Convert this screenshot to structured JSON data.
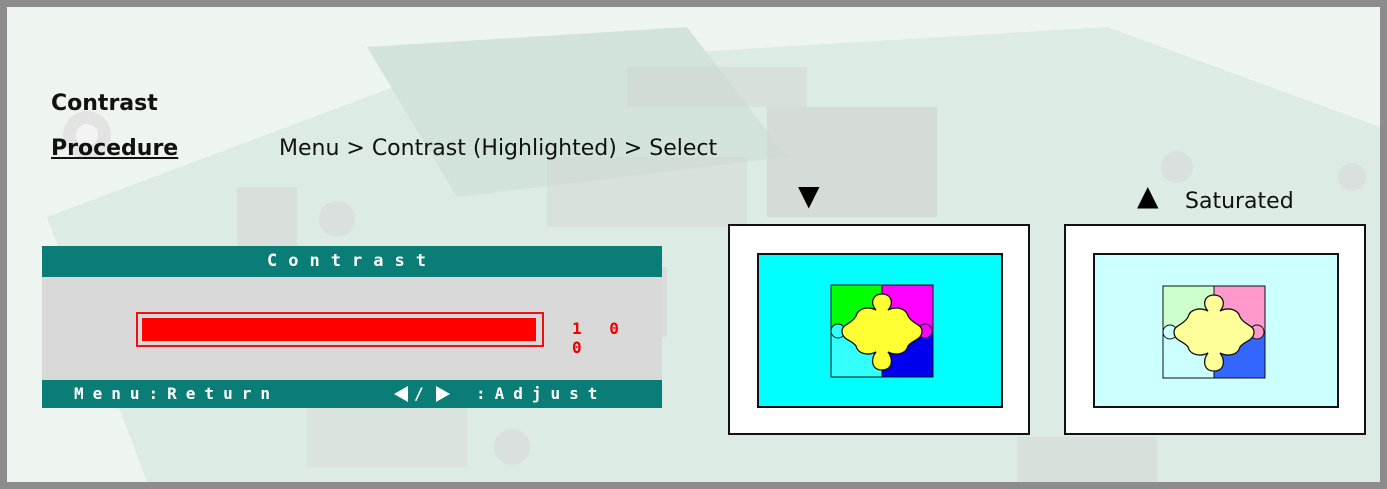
{
  "heading": {
    "title": "Contrast"
  },
  "procedure": {
    "label": "Procedure",
    "text": "Menu > Contrast (Highlighted) > Select"
  },
  "osd": {
    "title": "Contrast",
    "value": "1 0 0",
    "level_percent": 100,
    "footer": {
      "menu": "Menu:Return",
      "sep": "/",
      "adjust": ":Adjust"
    },
    "colors": {
      "header": "#0a7d77",
      "panel": "#d9d9d9",
      "bar": "#ff0000"
    }
  },
  "comparison": {
    "low_marker": "▼",
    "high_marker": "▲",
    "high_label": "Saturated",
    "low_screen_color": "#00ffff",
    "high_screen_color": "#ccffff"
  }
}
